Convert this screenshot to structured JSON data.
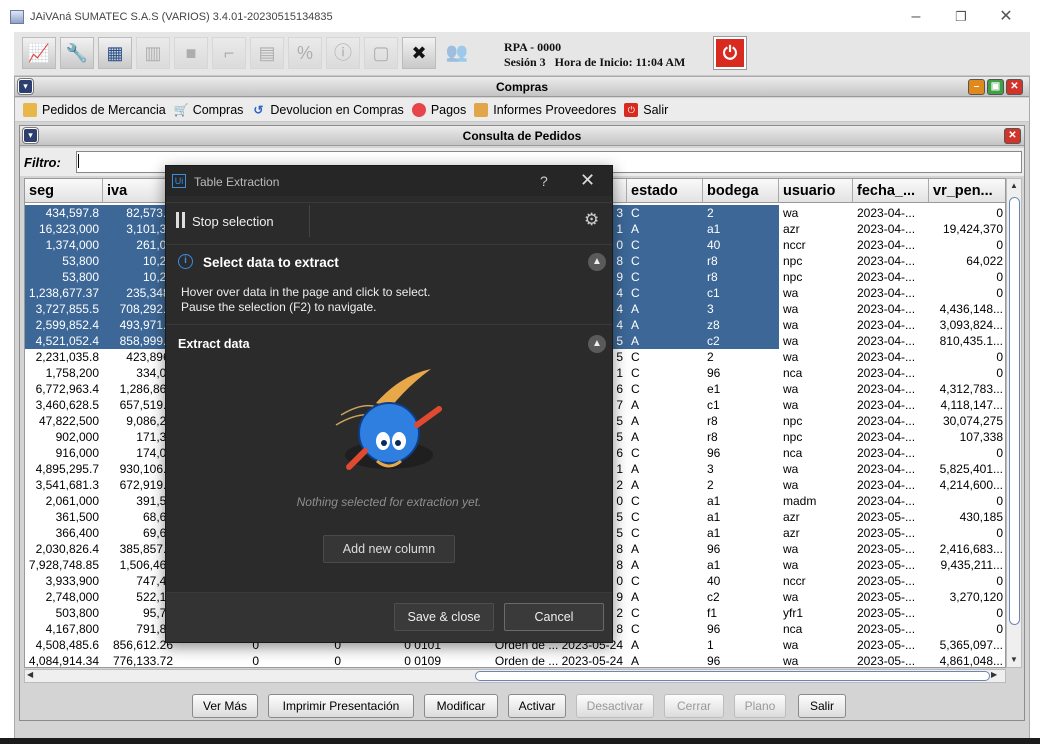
{
  "window": {
    "title": "JAiVAná SUMATEC S.A.S (VARIOS) 3.4.01-20230515134835"
  },
  "session": {
    "rpa": "RPA - 0000",
    "info": "Sesión 3   Hora de Inicio: 11:04 AM"
  },
  "toolbar_icons": [
    "chart-icon",
    "tools-icon",
    "calculator-icon",
    "factory-icon",
    "box-icon",
    "stairs-icon",
    "ledger-icon",
    "percent-icon",
    "info-icon",
    "document-icon",
    "wrench-icon",
    "users-icon"
  ],
  "compras": {
    "title": "Compras",
    "menu": [
      "Pedidos de Mercancia",
      "Compras",
      "Devolucion en Compras",
      "Pagos",
      "Informes Proveedores",
      "Salir"
    ]
  },
  "consulta": {
    "title": "Consulta de Pedidos",
    "filter_label": "Filtro:",
    "filter_value": ""
  },
  "table": {
    "columns": [
      "seg",
      "iva",
      "",
      "",
      "",
      "",
      "estado",
      "bodega",
      "usuario",
      "fecha_...",
      "vr_pen..."
    ],
    "rows": [
      {
        "seg": "434,597.8",
        "iva": "82,573.5",
        "c3": "",
        "c4": "",
        "c5": "",
        "c6": "3",
        "estado": "C",
        "bodega": "2",
        "usuario": "wa",
        "fecha": "2023-04-...",
        "vr": "0",
        "sel": true
      },
      {
        "seg": "16,323,000",
        "iva": "3,101,37",
        "c3": "",
        "c4": "",
        "c5": "",
        "c6": "1",
        "estado": "A",
        "bodega": "a1",
        "usuario": "azr",
        "fecha": "2023-04-...",
        "vr": "19,424,370",
        "sel": true
      },
      {
        "seg": "1,374,000",
        "iva": "261,06",
        "c3": "",
        "c4": "",
        "c5": "",
        "c6": "0",
        "estado": "C",
        "bodega": "40",
        "usuario": "nccr",
        "fecha": "2023-04-...",
        "vr": "0",
        "sel": true
      },
      {
        "seg": "53,800",
        "iva": "10,22",
        "c3": "",
        "c4": "",
        "c5": "",
        "c6": "8",
        "estado": "C",
        "bodega": "r8",
        "usuario": "npc",
        "fecha": "2023-04-...",
        "vr": "64,022",
        "sel": true
      },
      {
        "seg": "53,800",
        "iva": "10,22",
        "c3": "",
        "c4": "",
        "c5": "",
        "c6": "9",
        "estado": "C",
        "bodega": "r8",
        "usuario": "npc",
        "fecha": "2023-04-...",
        "vr": "0",
        "sel": true
      },
      {
        "seg": "1,238,677.37",
        "iva": "235,348.",
        "c3": "",
        "c4": "",
        "c5": "",
        "c6": "4",
        "estado": "C",
        "bodega": "c1",
        "usuario": "wa",
        "fecha": "2023-04-...",
        "vr": "0",
        "sel": true
      },
      {
        "seg": "3,727,855.5",
        "iva": "708,292.5",
        "c3": "",
        "c4": "",
        "c5": "",
        "c6": "4",
        "estado": "A",
        "bodega": "3",
        "usuario": "wa",
        "fecha": "2023-04-...",
        "vr": "4,436,148...",
        "sel": true
      },
      {
        "seg": "2,599,852.4",
        "iva": "493,971.9",
        "c3": "",
        "c4": "",
        "c5": "",
        "c6": "4",
        "estado": "A",
        "bodega": "z8",
        "usuario": "wa",
        "fecha": "2023-04-...",
        "vr": "3,093,824...",
        "sel": true
      },
      {
        "seg": "4,521,052.4",
        "iva": "858,999.9",
        "c3": "",
        "c4": "",
        "c5": "",
        "c6": "5",
        "estado": "A",
        "bodega": "c2",
        "usuario": "wa",
        "fecha": "2023-04-...",
        "vr": "810,435.1...",
        "sel": true
      },
      {
        "seg": "2,231,035.8",
        "iva": "423,896.",
        "c3": "",
        "c4": "",
        "c5": "",
        "c6": "5",
        "estado": "C",
        "bodega": "2",
        "usuario": "wa",
        "fecha": "2023-04-...",
        "vr": "0",
        "sel": false
      },
      {
        "seg": "1,758,200",
        "iva": "334,05",
        "c3": "",
        "c4": "",
        "c5": "",
        "c6": "1",
        "estado": "C",
        "bodega": "96",
        "usuario": "nca",
        "fecha": "2023-04-...",
        "vr": "0",
        "sel": false
      },
      {
        "seg": "6,772,963.4",
        "iva": "1,286,863",
        "c3": "",
        "c4": "",
        "c5": "",
        "c6": "6",
        "estado": "C",
        "bodega": "e1",
        "usuario": "wa",
        "fecha": "2023-04-...",
        "vr": "4,312,783...",
        "sel": false
      },
      {
        "seg": "3,460,628.5",
        "iva": "657,519.4",
        "c3": "",
        "c4": "",
        "c5": "",
        "c6": "7",
        "estado": "A",
        "bodega": "c1",
        "usuario": "wa",
        "fecha": "2023-04-...",
        "vr": "4,118,147...",
        "sel": false
      },
      {
        "seg": "47,822,500",
        "iva": "9,086,27",
        "c3": "",
        "c4": "",
        "c5": "",
        "c6": "5",
        "estado": "A",
        "bodega": "r8",
        "usuario": "npc",
        "fecha": "2023-04-...",
        "vr": "30,074,275",
        "sel": false
      },
      {
        "seg": "902,000",
        "iva": "171,38",
        "c3": "",
        "c4": "",
        "c5": "",
        "c6": "5",
        "estado": "A",
        "bodega": "r8",
        "usuario": "npc",
        "fecha": "2023-04-...",
        "vr": "107,338",
        "sel": false
      },
      {
        "seg": "916,000",
        "iva": "174,04",
        "c3": "",
        "c4": "",
        "c5": "",
        "c6": "6",
        "estado": "C",
        "bodega": "96",
        "usuario": "nca",
        "fecha": "2023-04-...",
        "vr": "0",
        "sel": false
      },
      {
        "seg": "4,895,295.7",
        "iva": "930,106.1",
        "c3": "",
        "c4": "",
        "c5": "",
        "c6": "1",
        "estado": "A",
        "bodega": "3",
        "usuario": "wa",
        "fecha": "2023-04-...",
        "vr": "5,825,401...",
        "sel": false
      },
      {
        "seg": "3,541,681.3",
        "iva": "672,919.4",
        "c3": "",
        "c4": "",
        "c5": "",
        "c6": "2",
        "estado": "A",
        "bodega": "2",
        "usuario": "wa",
        "fecha": "2023-04-...",
        "vr": "4,214,600...",
        "sel": false
      },
      {
        "seg": "2,061,000",
        "iva": "391,59",
        "c3": "",
        "c4": "",
        "c5": "",
        "c6": "0",
        "estado": "C",
        "bodega": "a1",
        "usuario": "madm",
        "fecha": "2023-04-...",
        "vr": "0",
        "sel": false
      },
      {
        "seg": "361,500",
        "iva": "68,68",
        "c3": "",
        "c4": "",
        "c5": "",
        "c6": "5",
        "estado": "C",
        "bodega": "a1",
        "usuario": "azr",
        "fecha": "2023-05-...",
        "vr": "430,185",
        "sel": false
      },
      {
        "seg": "366,400",
        "iva": "69,61",
        "c3": "",
        "c4": "",
        "c5": "",
        "c6": "5",
        "estado": "C",
        "bodega": "a1",
        "usuario": "azr",
        "fecha": "2023-05-...",
        "vr": "0",
        "sel": false
      },
      {
        "seg": "2,030,826.4",
        "iva": "385,857.0",
        "c3": "",
        "c4": "",
        "c5": "",
        "c6": "8",
        "estado": "A",
        "bodega": "96",
        "usuario": "wa",
        "fecha": "2023-05-...",
        "vr": "2,416,683...",
        "sel": false
      },
      {
        "seg": "7,928,748.85",
        "iva": "1,506,462",
        "c3": "",
        "c4": "",
        "c5": "",
        "c6": "8",
        "estado": "A",
        "bodega": "a1",
        "usuario": "wa",
        "fecha": "2023-05-...",
        "vr": "9,435,211...",
        "sel": false
      },
      {
        "seg": "3,933,900",
        "iva": "747,44",
        "c3": "",
        "c4": "",
        "c5": "",
        "c6": "0",
        "estado": "C",
        "bodega": "40",
        "usuario": "nccr",
        "fecha": "2023-05-...",
        "vr": "0",
        "sel": false
      },
      {
        "seg": "2,748,000",
        "iva": "522,12",
        "c3": "",
        "c4": "",
        "c5": "",
        "c6": "9",
        "estado": "A",
        "bodega": "c2",
        "usuario": "wa",
        "fecha": "2023-05-...",
        "vr": "3,270,120",
        "sel": false
      },
      {
        "seg": "503,800",
        "iva": "95,72",
        "c3": "",
        "c4": "",
        "c5": "",
        "c6": "2",
        "estado": "C",
        "bodega": "f1",
        "usuario": "yfr1",
        "fecha": "2023-05-...",
        "vr": "0",
        "sel": false
      },
      {
        "seg": "4,167,800",
        "iva": "791,88",
        "c3": "",
        "c4": "",
        "c5": "",
        "c6": "8",
        "estado": "C",
        "bodega": "96",
        "usuario": "nca",
        "fecha": "2023-05-...",
        "vr": "0",
        "sel": false
      },
      {
        "seg": "4,508,485.6",
        "iva": "856,612.26",
        "c3": "0",
        "c4": "0",
        "c5": "0  0101",
        "c6": "Orden de ...   2023-05-24",
        "estado": "A",
        "bodega": "1",
        "usuario": "wa",
        "fecha": "2023-05-...",
        "vr": "5,365,097...",
        "sel": false
      },
      {
        "seg": "4,084,914.34",
        "iva": "776,133.72",
        "c3": "0",
        "c4": "0",
        "c5": "0  0109",
        "c6": "Orden de ...   2023-05-24",
        "estado": "A",
        "bodega": "96",
        "usuario": "wa",
        "fecha": "2023-05-...",
        "vr": "4,861,048...",
        "sel": false
      }
    ]
  },
  "buttons": [
    {
      "label": "Ver Más",
      "enabled": true
    },
    {
      "label": "Imprimir Presentación",
      "enabled": true
    },
    {
      "label": "Modificar",
      "enabled": true
    },
    {
      "label": "Activar",
      "enabled": true
    },
    {
      "label": "Desactivar",
      "enabled": false
    },
    {
      "label": "Cerrar",
      "enabled": false
    },
    {
      "label": "Plano",
      "enabled": false
    },
    {
      "label": "Salir",
      "enabled": true
    }
  ],
  "dialog": {
    "logo": "Ui",
    "title": "Table Extraction",
    "help": "?",
    "close": "✕",
    "stop_label": "Stop selection",
    "select_heading": "Select data to extract",
    "select_line1": "Hover over data in the page and click to select.",
    "select_line2": "Pause the selection (F2) to navigate.",
    "extract_heading": "Extract data",
    "empty_text": "Nothing selected for extraction yet.",
    "add_column": "Add new column",
    "save_close": "Save & close",
    "cancel": "Cancel"
  },
  "colors": {
    "selection": "#3c6796",
    "accent": "#3b8de0",
    "dialog_bg": "#2b2b2b",
    "power": "#d82a1e"
  }
}
